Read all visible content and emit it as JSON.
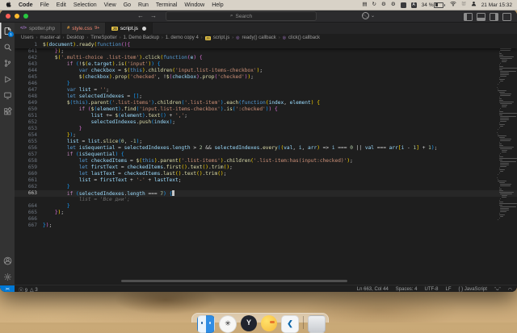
{
  "colors": {
    "accent_blue": "#0078d4",
    "error_red": "#f48771",
    "tab_active_bg": "#1e1e1e",
    "statusbar_bg": "#1f1f1f",
    "js_icon_yellow": "#e8c545"
  },
  "menubar": {
    "items": [
      "Code",
      "File",
      "Edit",
      "Selection",
      "View",
      "Go",
      "Run",
      "Terminal",
      "Window",
      "Help"
    ],
    "status_icons": [
      "display-icon",
      "sync-icon",
      "gear-icon",
      "gear-icon-2",
      "app-box-icon",
      "input-source-A"
    ],
    "battery_percent": "34 %",
    "datetime": "21 Mar 15:32"
  },
  "titlebar": {
    "search_placeholder": "Search",
    "copilot_chevron": "⌄"
  },
  "tabs": [
    {
      "label": "spotter.php",
      "icon": "php",
      "badge": "",
      "active": false,
      "modified": false,
      "error": false
    },
    {
      "label": "style.css",
      "icon": "css",
      "badge": "9+",
      "active": false,
      "modified": false,
      "error": true
    },
    {
      "label": "script.js",
      "icon": "js",
      "badge": "",
      "active": true,
      "modified": true,
      "error": false
    }
  ],
  "breadcrumbs": {
    "path": [
      "Users",
      "master-al",
      "Desktop",
      "TimeSpotter",
      "1. Demo Backup",
      "1. demo copy 4"
    ],
    "file": "script.js",
    "symbols": [
      "ready() callback",
      "click() callback"
    ]
  },
  "editor": {
    "sticky_line": {
      "n": "1",
      "t": "$(document).ready(function(){"
    },
    "lines": [
      {
        "n": "641",
        "t": "    });"
      },
      {
        "n": "642",
        "t": "    $('.multi-choice .list-item').click(function(e) {"
      },
      {
        "n": "643",
        "t": "        if (!$(e.target).is('input')) {"
      },
      {
        "n": "644",
        "t": "            var checkbox = $(this).children('input.list-items-checkbox');"
      },
      {
        "n": "645",
        "t": "            $(checkbox).prop('checked', !$(checkbox).prop('checked'));"
      },
      {
        "n": "646",
        "t": "        }"
      },
      {
        "n": "647",
        "t": "        var list = '';"
      },
      {
        "n": "648",
        "t": "        let selectedIndexes = [];"
      },
      {
        "n": "649",
        "t": "        $(this).parent('.list-items').children('.list-item').each(function(index, element) {"
      },
      {
        "n": "650",
        "t": "            if ($(element).find('input.list-items-checkbox').is(':checked')) {"
      },
      {
        "n": "651",
        "t": "                list += $(element).text() + ',';"
      },
      {
        "n": "652",
        "t": "                selectedIndexes.push(index);"
      },
      {
        "n": "653",
        "t": "            }"
      },
      {
        "n": "654",
        "t": "        });"
      },
      {
        "n": "655",
        "t": "        list = list.slice(0, -1);"
      },
      {
        "n": "656",
        "t": "        let isSequential = selectedIndexes.length > 2 && selectedIndexes.every((val, i, arr) => i === 0 || val === arr[i - 1] + 1);"
      },
      {
        "n": "657",
        "t": "        if (isSequential) {"
      },
      {
        "n": "658",
        "t": "            let checkedItems = $(this).parent('.list-items').children('.list-item:has(input:checked)');"
      },
      {
        "n": "659",
        "t": "            let firstText = checkedItems.first().text().trim();"
      },
      {
        "n": "660",
        "t": "            let lastText = checkedItems.last().text().trim();"
      },
      {
        "n": "661",
        "t": "            list = firstText + '-' + lastText;"
      },
      {
        "n": "662",
        "t": "        }"
      },
      {
        "n": "663",
        "t": "        if (selectedIndexes.length === 7) {",
        "current": true,
        "cursor": true
      },
      {
        "n": "",
        "t": "            list = 'Все дни';",
        "ghost": true
      },
      {
        "n": "664",
        "t": "        }"
      },
      {
        "n": "665",
        "t": "    });"
      },
      {
        "n": "666",
        "t": ""
      },
      {
        "n": "667",
        "t": "});"
      }
    ]
  },
  "statusbar": {
    "remote_glyph": "><",
    "errors": "9",
    "warnings": "3",
    "error_icon": "ⓧ",
    "warning_icon": "△",
    "line_col": "Ln 663, Col 44",
    "spaces": "Spaces: 4",
    "encoding": "UTF-8",
    "eol": "LF",
    "lang_icon": "{ }",
    "language": "JavaScript",
    "copilot_glyph": "ᵔᴗᵔ",
    "bell_glyph": "◠"
  },
  "dock": {
    "items": [
      "finder",
      "chatgpt",
      "yandex",
      "duck",
      "vscode",
      "trash"
    ]
  }
}
